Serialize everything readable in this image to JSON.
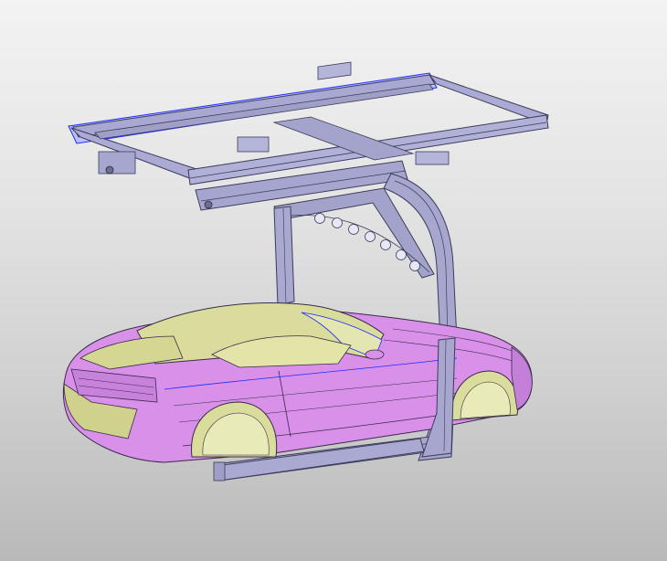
{
  "viewport": {
    "background_top": "#f3f3f3",
    "background_bottom": "#b9b9b9"
  },
  "model": {
    "fixture_color": "#a9a9cf",
    "fixture_edge": "#3c3c5a",
    "selection_highlight": "#1f2bff",
    "car_body_color": "#d88fe8",
    "car_glass_color": "#d9dc9a",
    "car_edge": "#3a2b4a"
  }
}
